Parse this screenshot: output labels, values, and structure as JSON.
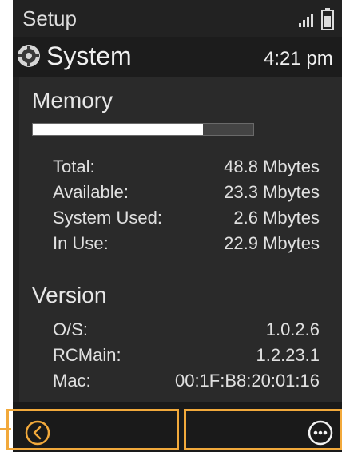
{
  "status_bar": {
    "title": "Setup",
    "signal_icon": "signal-bars-icon",
    "battery_icon": "battery-icon"
  },
  "header": {
    "icon": "system-gear-icon",
    "title": "System",
    "time": "4:21 pm"
  },
  "memory": {
    "title": "Memory",
    "usage_fraction": 0.77,
    "rows": [
      {
        "label": "Total:",
        "value": "48.8 Mbytes"
      },
      {
        "label": "Available:",
        "value": "23.3 Mbytes"
      },
      {
        "label": "System Used:",
        "value": "2.6 Mbytes"
      },
      {
        "label": "In Use:",
        "value": "22.9 Mbytes"
      }
    ]
  },
  "version": {
    "title": "Version",
    "rows": [
      {
        "label": "O/S:",
        "value": "1.0.2.6"
      },
      {
        "label": "RCMain:",
        "value": "1.2.23.1"
      },
      {
        "label": "Mac:",
        "value": "00:1F:B8:20:01:16"
      }
    ]
  },
  "bottom_bar": {
    "back_icon": "back-chevron-icon",
    "more_icon": "more-options-icon"
  },
  "colors": {
    "highlight": "#f2a93b",
    "background": "#222222",
    "text": "#e2e2e2"
  }
}
